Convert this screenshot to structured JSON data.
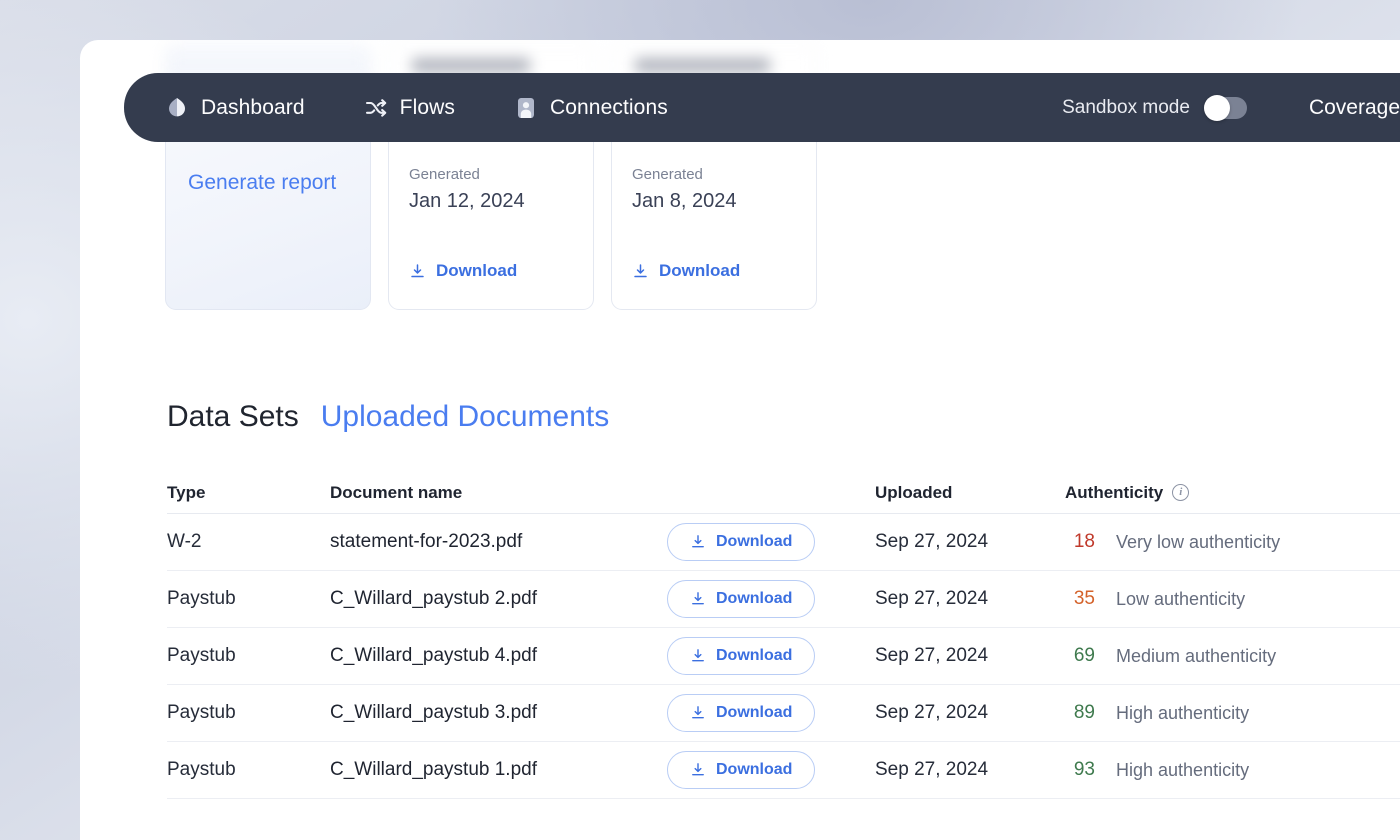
{
  "nav": {
    "items": [
      {
        "label": "Dashboard",
        "icon": "leaf-icon"
      },
      {
        "label": "Flows",
        "icon": "shuffle-icon"
      },
      {
        "label": "Connections",
        "icon": "contact-card-icon"
      }
    ],
    "sandbox_label": "Sandbox mode",
    "sandbox_enabled": false,
    "coverage_label": "Coverage"
  },
  "report_cards": [
    {
      "generate_label": "Generate report",
      "primary": true
    },
    {
      "generated_label": "Generated",
      "date": "Jan 12, 2024",
      "download_label": "Download"
    },
    {
      "generated_label": "Generated",
      "date": "Jan 8, 2024",
      "download_label": "Download"
    }
  ],
  "section": {
    "tab_inactive": "Data Sets",
    "tab_active": "Uploaded Documents"
  },
  "table": {
    "headers": {
      "type": "Type",
      "name": "Document name",
      "download": "",
      "uploaded": "Uploaded",
      "authenticity": "Authenticity"
    },
    "info_icon": "i",
    "download_label": "Download",
    "rows": [
      {
        "type": "W-2",
        "name": "statement-for-2023.pdf",
        "uploaded": "Sep 27, 2024",
        "score": "18",
        "score_color": "#c0392b",
        "auth_label": "Very low authenticity"
      },
      {
        "type": "Paystub",
        "name": "C_Willard_paystub 2.pdf",
        "uploaded": "Sep 27, 2024",
        "score": "35",
        "score_color": "#d4622a",
        "auth_label": "Low authenticity"
      },
      {
        "type": "Paystub",
        "name": "C_Willard_paystub 4.pdf",
        "uploaded": "Sep 27, 2024",
        "score": "69",
        "score_color": "#3f7a4e",
        "auth_label": "Medium authenticity"
      },
      {
        "type": "Paystub",
        "name": "C_Willard_paystub 3.pdf",
        "uploaded": "Sep 27, 2024",
        "score": "89",
        "score_color": "#3f7a4e",
        "auth_label": "High authenticity"
      },
      {
        "type": "Paystub",
        "name": "C_Willard_paystub 1.pdf",
        "uploaded": "Sep 27, 2024",
        "score": "93",
        "score_color": "#3f7a4e",
        "auth_label": "High authenticity"
      }
    ]
  },
  "colors": {
    "nav_bg": "#343c4e",
    "accent_blue": "#4a7df0",
    "link_blue": "#3b6fe0",
    "text_dark": "#1f2430",
    "muted": "#7b8294"
  }
}
